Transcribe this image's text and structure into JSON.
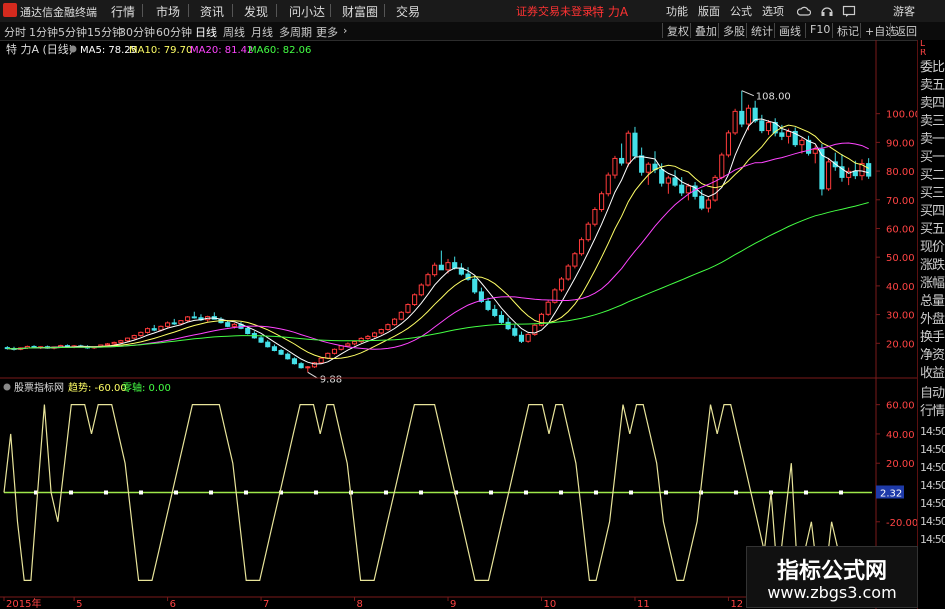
{
  "menubar": {
    "app_name": "通达信金融终端",
    "items": [
      "行情",
      "市场",
      "资讯",
      "发现",
      "问小达",
      "财富圈",
      "交易"
    ],
    "login_status": "证券交易未登录",
    "stock_name": "特 力A",
    "right_items": [
      "功能",
      "版面",
      "公式",
      "选项"
    ],
    "guest": "游客"
  },
  "toolbar": {
    "periods": [
      "分时",
      "1分钟",
      "5分钟",
      "15分钟",
      "30分钟",
      "60分钟",
      "日线",
      "周线",
      "月线",
      "多周期",
      "更多"
    ],
    "active_period": "日线",
    "right_buttons": [
      "复权",
      "叠加",
      "多股",
      "统计",
      "画线",
      "F10",
      "标记",
      "+自选",
      "返回"
    ]
  },
  "main_panel": {
    "title": "特 力A (日线)",
    "legend": [
      {
        "label": "MA5: 78.25",
        "color": "#ffffff"
      },
      {
        "label": "MA10: 79.70",
        "color": "#ffff66"
      },
      {
        "label": "MA20: 81.42",
        "color": "#ff44ff"
      },
      {
        "label": "MA60: 82.06",
        "color": "#44ff44"
      }
    ]
  },
  "sub_panel": {
    "title": "股票指标网",
    "trend_label": "趋势: -60.00",
    "zero_label": "零轴: 0.00",
    "value_box": "2.32"
  },
  "chart_data": [
    {
      "type": "candlestick",
      "title": "特 力A (日线)",
      "y_ticks": [
        20,
        30,
        40,
        50,
        60,
        70,
        80,
        90,
        100
      ],
      "ylim": [
        10,
        118
      ],
      "annotations": [
        {
          "text": "108.00"
        },
        {
          "text": "9.88"
        }
      ],
      "x_labels": [
        "2015年",
        "5",
        "6",
        "7",
        "8",
        "9",
        "10",
        "11",
        "12"
      ],
      "bars": [
        [
          18.5,
          19,
          17.8,
          18.2
        ],
        [
          18.2,
          18.8,
          17.5,
          17.9
        ],
        [
          17.9,
          18.6,
          17.6,
          18.4
        ],
        [
          18.4,
          19.2,
          18.0,
          18.9
        ],
        [
          18.9,
          19.3,
          18.2,
          18.5
        ],
        [
          18.5,
          19.0,
          18.0,
          18.8
        ],
        [
          18.8,
          19.2,
          18.1,
          18.3
        ],
        [
          18.3,
          18.9,
          17.9,
          18.7
        ],
        [
          18.7,
          19.5,
          18.4,
          19.2
        ],
        [
          19.2,
          19.6,
          18.5,
          18.8
        ],
        [
          18.8,
          19.4,
          18.3,
          19.1
        ],
        [
          19.1,
          19.5,
          18.6,
          18.9
        ],
        [
          18.9,
          19.3,
          18.1,
          18.4
        ],
        [
          18.4,
          19.0,
          18.0,
          18.8
        ],
        [
          18.8,
          19.6,
          18.5,
          19.4
        ],
        [
          19.4,
          20.1,
          19.0,
          19.8
        ],
        [
          19.8,
          20.6,
          19.4,
          20.3
        ],
        [
          20.3,
          21.2,
          20.0,
          20.9
        ],
        [
          20.9,
          22.0,
          20.6,
          21.8
        ],
        [
          21.8,
          23.0,
          21.4,
          22.7
        ],
        [
          22.7,
          24.1,
          22.3,
          23.8
        ],
        [
          23.8,
          25.5,
          23.4,
          25.1
        ],
        [
          25.1,
          26.4,
          24.2,
          24.6
        ],
        [
          24.6,
          26.2,
          24.1,
          25.9
        ],
        [
          25.9,
          27.6,
          25.5,
          27.1
        ],
        [
          27.1,
          28.5,
          26.4,
          26.8
        ],
        [
          26.8,
          28.1,
          26.2,
          27.9
        ],
        [
          27.9,
          29.5,
          27.4,
          29.2
        ],
        [
          29.2,
          31.0,
          28.6,
          28.9
        ],
        [
          28.9,
          30.1,
          27.8,
          28.2
        ],
        [
          28.2,
          29.6,
          27.5,
          29.3
        ],
        [
          29.3,
          30.8,
          28.7,
          28.4
        ],
        [
          28.4,
          29.1,
          26.9,
          27.2
        ],
        [
          27.2,
          28.0,
          25.6,
          25.9
        ],
        [
          25.9,
          27.1,
          25.1,
          26.6
        ],
        [
          26.6,
          27.4,
          24.9,
          25.2
        ],
        [
          25.2,
          25.8,
          23.1,
          23.4
        ],
        [
          23.4,
          24.2,
          21.6,
          21.9
        ],
        [
          21.9,
          22.7,
          20.1,
          20.4
        ],
        [
          20.4,
          21.1,
          18.5,
          18.8
        ],
        [
          18.8,
          19.6,
          17.2,
          17.5
        ],
        [
          17.5,
          18.0,
          15.9,
          16.2
        ],
        [
          16.2,
          16.8,
          14.3,
          14.6
        ],
        [
          14.6,
          15.1,
          12.6,
          12.9
        ],
        [
          12.9,
          13.4,
          11.2,
          11.5
        ],
        [
          11.5,
          12.1,
          9.88,
          11.8
        ],
        [
          11.8,
          13.5,
          11.4,
          13.2
        ],
        [
          13.2,
          15.1,
          12.9,
          14.8
        ],
        [
          14.8,
          16.8,
          14.5,
          16.5
        ],
        [
          16.5,
          18.2,
          16.1,
          17.9
        ],
        [
          17.9,
          19.4,
          17.5,
          19.1
        ],
        [
          19.1,
          20.3,
          18.6,
          19.8
        ],
        [
          19.8,
          21.0,
          19.3,
          20.6
        ],
        [
          20.6,
          22.1,
          20.1,
          21.7
        ],
        [
          21.7,
          22.9,
          21.2,
          22.4
        ],
        [
          22.4,
          24.0,
          22.0,
          23.6
        ],
        [
          23.6,
          25.1,
          23.1,
          24.8
        ],
        [
          24.8,
          26.9,
          24.4,
          26.5
        ],
        [
          26.5,
          28.8,
          26.1,
          28.4
        ],
        [
          28.4,
          31.2,
          28.0,
          30.8
        ],
        [
          30.8,
          33.9,
          30.4,
          33.5
        ],
        [
          33.5,
          37.4,
          33.0,
          36.9
        ],
        [
          36.9,
          40.9,
          36.4,
          40.3
        ],
        [
          40.3,
          44.6,
          39.8,
          43.9
        ],
        [
          43.9,
          48.1,
          43.2,
          47.2
        ],
        [
          47.2,
          52.3,
          46.5,
          45.6
        ],
        [
          45.6,
          49.4,
          44.3,
          48.1
        ],
        [
          48.1,
          50.2,
          45.7,
          46.2
        ],
        [
          46.2,
          47.9,
          43.6,
          44.1
        ],
        [
          44.1,
          46.5,
          41.8,
          42.3
        ],
        [
          42.3,
          43.6,
          37.2,
          37.9
        ],
        [
          37.9,
          39.4,
          34.1,
          34.6
        ],
        [
          34.6,
          35.9,
          31.2,
          31.8
        ],
        [
          31.8,
          33.4,
          29.1,
          29.7
        ],
        [
          29.7,
          31.2,
          26.8,
          27.3
        ],
        [
          27.3,
          28.9,
          24.6,
          25.1
        ],
        [
          25.1,
          26.4,
          22.3,
          22.8
        ],
        [
          22.8,
          24.1,
          20.1,
          20.7
        ],
        [
          20.7,
          23.5,
          20.2,
          23.1
        ],
        [
          23.1,
          26.8,
          22.6,
          26.3
        ],
        [
          26.3,
          30.6,
          25.9,
          30.1
        ],
        [
          30.1,
          34.9,
          29.6,
          34.3
        ],
        [
          34.3,
          39.2,
          33.8,
          38.6
        ],
        [
          38.6,
          43.1,
          37.9,
          42.4
        ],
        [
          42.4,
          47.6,
          41.8,
          46.9
        ],
        [
          46.9,
          51.8,
          46.1,
          51.2
        ],
        [
          51.2,
          56.9,
          50.5,
          56.1
        ],
        [
          56.1,
          62.3,
          55.4,
          61.5
        ],
        [
          61.5,
          67.4,
          60.7,
          66.6
        ],
        [
          66.6,
          72.9,
          65.8,
          72.1
        ],
        [
          72.1,
          79.5,
          71.2,
          78.6
        ],
        [
          78.6,
          85.3,
          77.4,
          84.4
        ],
        [
          84.4,
          89.6,
          81.9,
          82.8
        ],
        [
          82.8,
          94.1,
          81.6,
          93.2
        ],
        [
          93.2,
          95.4,
          84.1,
          85.3
        ],
        [
          85.3,
          88.2,
          78.4,
          79.6
        ],
        [
          79.6,
          83.1,
          75.2,
          82.4
        ],
        [
          82.4,
          86.9,
          79.3,
          80.5
        ],
        [
          80.5,
          82.7,
          74.6,
          75.8
        ],
        [
          75.8,
          78.4,
          72.1,
          77.6
        ],
        [
          77.6,
          80.3,
          74.5,
          75.1
        ],
        [
          75.1,
          77.9,
          71.3,
          72.4
        ],
        [
          72.4,
          75.6,
          69.8,
          74.8
        ],
        [
          74.8,
          76.2,
          70.1,
          71.2
        ],
        [
          71.2,
          73.5,
          66.4,
          67.1
        ],
        [
          67.1,
          70.8,
          65.6,
          69.9
        ],
        [
          69.9,
          78.6,
          69.3,
          77.8
        ],
        [
          77.8,
          86.4,
          77.1,
          85.6
        ],
        [
          85.6,
          94.2,
          84.8,
          93.3
        ],
        [
          93.3,
          101.7,
          92.6,
          100.8
        ],
        [
          100.8,
          108.0,
          95.3,
          96.4
        ],
        [
          96.4,
          103.1,
          94.2,
          101.9
        ],
        [
          101.9,
          104.5,
          96.8,
          97.5
        ],
        [
          97.5,
          99.6,
          93.2,
          94.1
        ],
        [
          94.1,
          97.8,
          92.6,
          96.9
        ],
        [
          96.9,
          98.4,
          92.1,
          93.3
        ],
        [
          93.3,
          96.1,
          90.8,
          92.1
        ],
        [
          92.1,
          94.8,
          89.6,
          93.8
        ],
        [
          93.8,
          95.2,
          88.4,
          89.2
        ],
        [
          89.2,
          91.6,
          86.1,
          90.7
        ],
        [
          90.7,
          92.3,
          85.4,
          86.2
        ],
        [
          86.2,
          88.9,
          82.7,
          87.6
        ],
        [
          87.6,
          89.4,
          71.5,
          73.8
        ],
        [
          73.8,
          84.6,
          73.1,
          83.2
        ],
        [
          83.2,
          86.4,
          80.1,
          81.5
        ],
        [
          81.5,
          85.9,
          76.3,
          77.8
        ],
        [
          77.8,
          81.2,
          75.1,
          79.9
        ],
        [
          79.9,
          83.6,
          77.2,
          78.4
        ],
        [
          78.4,
          84.1,
          76.8,
          82.6
        ],
        [
          82.6,
          84.5,
          77.3,
          78.25
        ]
      ]
    },
    {
      "type": "line",
      "title": "股票指标网",
      "y_ticks": [
        60,
        40,
        20,
        -20,
        -40
      ],
      "ylim": [
        -70,
        70
      ],
      "zero_line": 0,
      "series": [
        {
          "name": "趋势",
          "values": [
            0,
            40,
            -20,
            -60,
            -60,
            0,
            60,
            0,
            -20,
            20,
            60,
            60,
            60,
            40,
            60,
            60,
            60,
            40,
            20,
            -20,
            -60,
            -60,
            -60,
            -40,
            -20,
            0,
            20,
            40,
            60,
            60,
            60,
            60,
            60,
            40,
            20,
            -20,
            -60,
            -60,
            -60,
            -40,
            -20,
            0,
            20,
            40,
            60,
            60,
            60,
            40,
            60,
            60,
            40,
            20,
            -20,
            -60,
            -60,
            -60,
            -40,
            -20,
            0,
            20,
            40,
            60,
            60,
            60,
            60,
            40,
            20,
            0,
            -20,
            -40,
            -60,
            -60,
            -60,
            -40,
            -20,
            0,
            20,
            40,
            60,
            60,
            60,
            40,
            60,
            60,
            40,
            20,
            -20,
            -60,
            -60,
            -40,
            -20,
            20,
            60,
            40,
            60,
            60,
            40,
            20,
            -20,
            -40,
            -60,
            -60,
            -40,
            -20,
            20,
            60,
            40,
            60,
            60,
            40,
            20,
            0,
            -20,
            -40,
            0,
            -60,
            -20,
            20,
            -60,
            -40,
            -20,
            -60,
            -60,
            -20,
            -40,
            -60,
            -60,
            -60,
            -40,
            -60
          ]
        }
      ]
    }
  ]
}
